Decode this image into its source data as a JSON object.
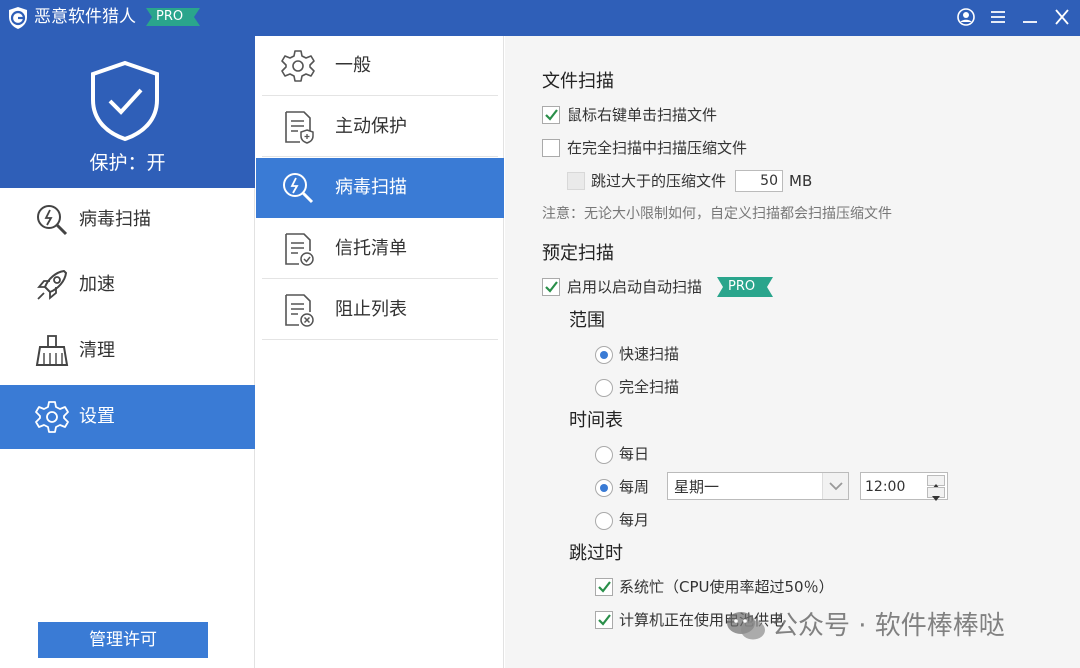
{
  "app": {
    "title": "恶意软件猎人",
    "badge": "PRO"
  },
  "window_controls": [
    "account-icon",
    "menu-icon",
    "minimize-icon",
    "close-icon"
  ],
  "sidebar": {
    "status": "保护：开",
    "items": [
      {
        "label": "病毒扫描",
        "icon": "virus-scan-icon",
        "active": false
      },
      {
        "label": "加速",
        "icon": "rocket-icon",
        "active": false
      },
      {
        "label": "清理",
        "icon": "broom-icon",
        "active": false
      },
      {
        "label": "设置",
        "icon": "gear-icon",
        "active": true
      }
    ],
    "manage_license": "管理许可"
  },
  "settings_nav": {
    "items": [
      {
        "label": "一般",
        "icon": "gear-icon",
        "active": false
      },
      {
        "label": "主动保护",
        "icon": "document-shield-icon",
        "active": false
      },
      {
        "label": "病毒扫描",
        "icon": "virus-scan-icon",
        "active": true
      },
      {
        "label": "信托清单",
        "icon": "document-check-icon",
        "active": false
      },
      {
        "label": "阻止列表",
        "icon": "document-block-icon",
        "active": false
      }
    ]
  },
  "content": {
    "file_scan": {
      "title": "文件扫描",
      "right_click_scan": {
        "label": "鼠标右键单击扫描文件",
        "checked": true
      },
      "scan_archives": {
        "label": "在完全扫描中扫描压缩文件",
        "checked": false
      },
      "skip_large": {
        "label": "跳过大于的压缩文件",
        "checked": false,
        "disabled": true,
        "value": "50",
        "unit": "MB"
      },
      "note": "注意：无论大小限制如何，自定义扫描都会扫描压缩文件"
    },
    "scheduled_scan": {
      "title": "预定扫描",
      "enable": {
        "label": "启用以启动自动扫描",
        "checked": true,
        "badge": "PRO"
      },
      "scope": {
        "title": "范围",
        "options": [
          {
            "label": "快速扫描",
            "selected": true
          },
          {
            "label": "完全扫描",
            "selected": false
          }
        ]
      },
      "schedule": {
        "title": "时间表",
        "options": [
          {
            "label": "每日",
            "selected": false
          },
          {
            "label": "每周",
            "selected": true
          },
          {
            "label": "每月",
            "selected": false
          }
        ],
        "weekday": "星期一",
        "time": "12:00"
      },
      "skip_when": {
        "title": "跳过时",
        "busy": {
          "label": "系统忙（CPU使用率超过50％）",
          "checked": true
        },
        "battery": {
          "label": "计算机正在使用电池供电",
          "checked": true
        }
      }
    }
  },
  "watermark": "公众号 · 软件棒棒哒",
  "colors": {
    "brand_blue": "#2f5fb8",
    "active_blue": "#3a7bd5",
    "pro_green": "#2aa58c"
  }
}
